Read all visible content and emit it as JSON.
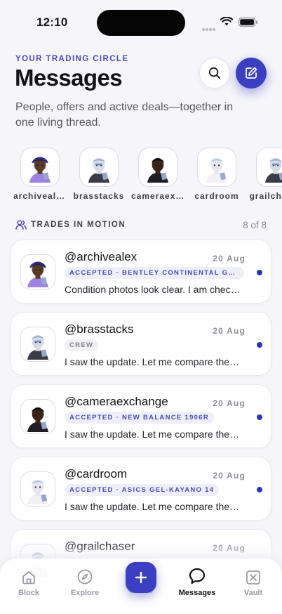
{
  "status_bar": {
    "time": "12:10"
  },
  "header": {
    "eyebrow": "YOUR TRADING CIRCLE",
    "title": "Messages",
    "subtitle": "People, offers and active deals—together in one living thread."
  },
  "stories": [
    {
      "label": "archivealex",
      "variant": "purple"
    },
    {
      "label": "brasstacks",
      "variant": "robot"
    },
    {
      "label": "cameraexchange",
      "variant": "dark"
    },
    {
      "label": "cardroom",
      "variant": "white"
    },
    {
      "label": "grailchaser",
      "variant": "robot"
    }
  ],
  "section": {
    "title": "TRADES IN MOTION",
    "count": "8 of 8"
  },
  "threads": [
    {
      "handle": "@archivealex",
      "date": "20 Aug",
      "badge": "ACCEPTED · BENTLEY CONTINENTAL GT SPEED",
      "badge_style": "accent",
      "preview": "Condition photos look clear. I am checking the details now.",
      "unread": true,
      "variant": "purple"
    },
    {
      "handle": "@brasstacks",
      "date": "20 Aug",
      "badge": "CREW",
      "badge_style": "grey",
      "preview": "I saw the update. Let me compare the terms and come back to you.",
      "unread": true,
      "variant": "robot"
    },
    {
      "handle": "@cameraexchange",
      "date": "20 Aug",
      "badge": "ACCEPTED · NEW BALANCE 1906R",
      "badge_style": "accent",
      "preview": "I saw the update. Let me compare the terms and come back to you.",
      "unread": true,
      "variant": "dark"
    },
    {
      "handle": "@cardroom",
      "date": "20 Aug",
      "badge": "ACCEPTED · ASICS GEL-KAYANO 14",
      "badge_style": "accent",
      "preview": "I saw the update. Let me compare the terms and come back to you.",
      "unread": true,
      "variant": "white"
    },
    {
      "handle": "@grailchaser",
      "date": "20 Aug",
      "badge": "",
      "badge_style": "accent",
      "preview": "",
      "unread": false,
      "variant": "robot"
    }
  ],
  "nav": {
    "items": [
      {
        "label": "Block",
        "icon": "home-icon",
        "active": false
      },
      {
        "label": "Explore",
        "icon": "compass-icon",
        "active": false
      },
      {
        "label": "Create",
        "icon": "plus-icon",
        "active": false
      },
      {
        "label": "Messages",
        "icon": "chat-bubble-icon",
        "active": true
      },
      {
        "label": "Vault",
        "icon": "vault-icon",
        "active": false
      }
    ]
  },
  "colors": {
    "accent": "#3b3fc2",
    "unread": "#2b35b8",
    "eyebrow": "#4a47b8",
    "background": "#f6f6fa"
  }
}
